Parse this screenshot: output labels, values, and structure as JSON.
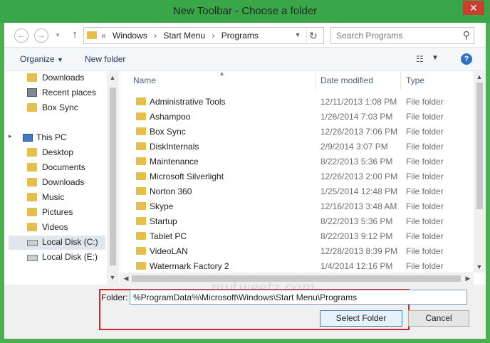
{
  "window": {
    "title": "New Toolbar - Choose a folder",
    "close_glyph": "✕"
  },
  "address_bar": {
    "chevron": "«",
    "crumbs": [
      "Windows",
      "Start Menu",
      "Programs"
    ],
    "separator": "›"
  },
  "search": {
    "placeholder": "Search Programs"
  },
  "toolbar": {
    "organize": "Organize",
    "new_folder": "New folder"
  },
  "nav_pane": {
    "items": [
      {
        "label": "Downloads",
        "icon": "folder-icon"
      },
      {
        "label": "Recent places",
        "icon": "recent-places-icon"
      },
      {
        "label": "Box Sync",
        "icon": "folder-icon"
      },
      {
        "label": "This PC",
        "icon": "pc-icon"
      },
      {
        "label": "Desktop",
        "icon": "folder-icon"
      },
      {
        "label": "Documents",
        "icon": "folder-icon"
      },
      {
        "label": "Downloads",
        "icon": "folder-icon"
      },
      {
        "label": "Music",
        "icon": "folder-icon"
      },
      {
        "label": "Pictures",
        "icon": "folder-icon"
      },
      {
        "label": "Videos",
        "icon": "folder-icon"
      },
      {
        "label": "Local Disk (C:)",
        "icon": "drive-icon",
        "selected": true
      },
      {
        "label": "Local Disk (E:)",
        "icon": "drive-icon"
      }
    ]
  },
  "file_list": {
    "columns": {
      "name": "Name",
      "date": "Date modified",
      "type": "Type"
    },
    "rows": [
      {
        "name": "Administrative Tools",
        "date": "12/11/2013 1:08 PM",
        "type": "File folder"
      },
      {
        "name": "Ashampoo",
        "date": "1/26/2014 7:03 PM",
        "type": "File folder"
      },
      {
        "name": "Box Sync",
        "date": "12/26/2013 7:06 PM",
        "type": "File folder"
      },
      {
        "name": "DiskInternals",
        "date": "2/9/2014 3:07 PM",
        "type": "File folder"
      },
      {
        "name": "Maintenance",
        "date": "8/22/2013 5:36 PM",
        "type": "File folder"
      },
      {
        "name": "Microsoft Silverlight",
        "date": "12/26/2013 2:00 PM",
        "type": "File folder"
      },
      {
        "name": "Norton 360",
        "date": "1/25/2014 12:48 PM",
        "type": "File folder"
      },
      {
        "name": "Skype",
        "date": "12/16/2013 3:48 AM",
        "type": "File folder"
      },
      {
        "name": "Startup",
        "date": "8/22/2013 5:36 PM",
        "type": "File folder"
      },
      {
        "name": "Tablet PC",
        "date": "8/22/2013 9:12 PM",
        "type": "File folder"
      },
      {
        "name": "VideoLAN",
        "date": "12/28/2013 8:39 PM",
        "type": "File folder"
      },
      {
        "name": "Watermark Factory 2",
        "date": "1/4/2014 12:16 PM",
        "type": "File folder"
      }
    ]
  },
  "bottom": {
    "folder_label": "Folder:",
    "folder_value": "%ProgramData%\\Microsoft\\Windows\\Start Menu\\Programs",
    "select_button": "Select Folder",
    "cancel_button": "Cancel",
    "watermark": "mytweetz.com",
    "highlight_color": "#d6262c"
  }
}
